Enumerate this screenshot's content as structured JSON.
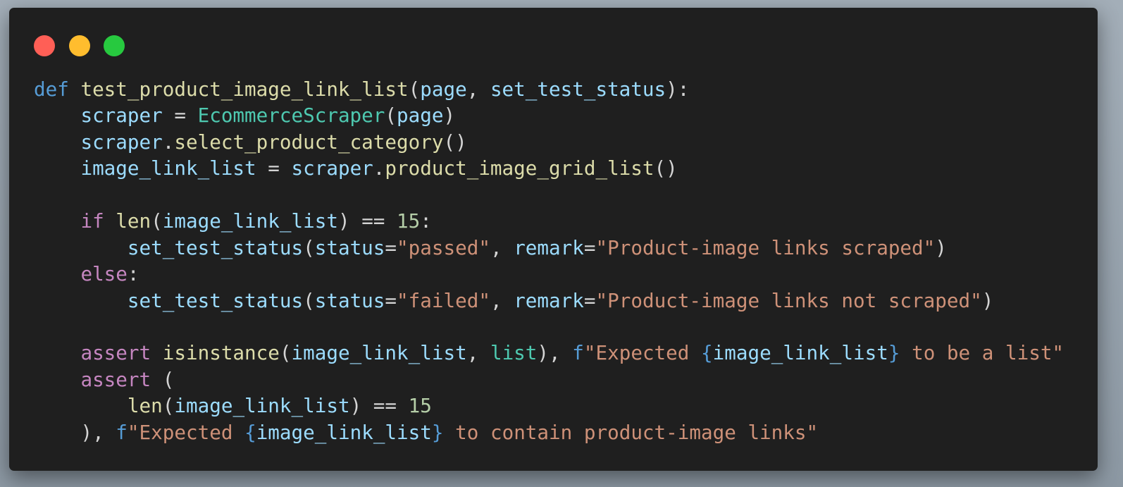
{
  "window_controls": [
    "close",
    "minimize",
    "maximize"
  ],
  "lines": [
    {
      "tokens": [
        {
          "t": "def ",
          "c": "kw"
        },
        {
          "t": "test_product_image_link_list",
          "c": "fn"
        },
        {
          "t": "(",
          "c": "p"
        },
        {
          "t": "page",
          "c": "var"
        },
        {
          "t": ", ",
          "c": "p"
        },
        {
          "t": "set_test_status",
          "c": "var"
        },
        {
          "t": "):",
          "c": "p"
        }
      ]
    },
    {
      "tokens": [
        {
          "t": "    ",
          "c": "p"
        },
        {
          "t": "scraper",
          "c": "var"
        },
        {
          "t": " = ",
          "c": "p"
        },
        {
          "t": "EcommerceScraper",
          "c": "cls"
        },
        {
          "t": "(",
          "c": "p"
        },
        {
          "t": "page",
          "c": "var"
        },
        {
          "t": ")",
          "c": "p"
        }
      ]
    },
    {
      "tokens": [
        {
          "t": "    ",
          "c": "p"
        },
        {
          "t": "scraper",
          "c": "var"
        },
        {
          "t": ".",
          "c": "p"
        },
        {
          "t": "select_product_category",
          "c": "fn"
        },
        {
          "t": "()",
          "c": "p"
        }
      ]
    },
    {
      "tokens": [
        {
          "t": "    ",
          "c": "p"
        },
        {
          "t": "image_link_list",
          "c": "var"
        },
        {
          "t": " = ",
          "c": "p"
        },
        {
          "t": "scraper",
          "c": "var"
        },
        {
          "t": ".",
          "c": "p"
        },
        {
          "t": "product_image_grid_list",
          "c": "fn"
        },
        {
          "t": "()",
          "c": "p"
        }
      ]
    },
    {
      "tokens": []
    },
    {
      "tokens": [
        {
          "t": "    ",
          "c": "p"
        },
        {
          "t": "if ",
          "c": "ctl"
        },
        {
          "t": "len",
          "c": "fn"
        },
        {
          "t": "(",
          "c": "p"
        },
        {
          "t": "image_link_list",
          "c": "var"
        },
        {
          "t": ") == ",
          "c": "p"
        },
        {
          "t": "15",
          "c": "num"
        },
        {
          "t": ":",
          "c": "p"
        }
      ]
    },
    {
      "tokens": [
        {
          "t": "        ",
          "c": "p"
        },
        {
          "t": "set_test_status",
          "c": "var"
        },
        {
          "t": "(",
          "c": "p"
        },
        {
          "t": "status",
          "c": "var"
        },
        {
          "t": "=",
          "c": "p"
        },
        {
          "t": "\"passed\"",
          "c": "str"
        },
        {
          "t": ", ",
          "c": "p"
        },
        {
          "t": "remark",
          "c": "var"
        },
        {
          "t": "=",
          "c": "p"
        },
        {
          "t": "\"Product-image links scraped\"",
          "c": "str"
        },
        {
          "t": ")",
          "c": "p"
        }
      ]
    },
    {
      "tokens": [
        {
          "t": "    ",
          "c": "p"
        },
        {
          "t": "else",
          "c": "ctl"
        },
        {
          "t": ":",
          "c": "p"
        }
      ]
    },
    {
      "tokens": [
        {
          "t": "        ",
          "c": "p"
        },
        {
          "t": "set_test_status",
          "c": "var"
        },
        {
          "t": "(",
          "c": "p"
        },
        {
          "t": "status",
          "c": "var"
        },
        {
          "t": "=",
          "c": "p"
        },
        {
          "t": "\"failed\"",
          "c": "str"
        },
        {
          "t": ", ",
          "c": "p"
        },
        {
          "t": "remark",
          "c": "var"
        },
        {
          "t": "=",
          "c": "p"
        },
        {
          "t": "\"Product-image links not scraped\"",
          "c": "str"
        },
        {
          "t": ")",
          "c": "p"
        }
      ]
    },
    {
      "tokens": []
    },
    {
      "tokens": [
        {
          "t": "    ",
          "c": "p"
        },
        {
          "t": "assert ",
          "c": "ctl"
        },
        {
          "t": "isinstance",
          "c": "fn"
        },
        {
          "t": "(",
          "c": "p"
        },
        {
          "t": "image_link_list",
          "c": "var"
        },
        {
          "t": ", ",
          "c": "p"
        },
        {
          "t": "list",
          "c": "cls"
        },
        {
          "t": "), ",
          "c": "p"
        },
        {
          "t": "f",
          "c": "kw"
        },
        {
          "t": "\"Expected ",
          "c": "str"
        },
        {
          "t": "{",
          "c": "kw"
        },
        {
          "t": "image_link_list",
          "c": "var"
        },
        {
          "t": "}",
          "c": "kw"
        },
        {
          "t": " to be a list\"",
          "c": "str"
        }
      ]
    },
    {
      "tokens": [
        {
          "t": "    ",
          "c": "p"
        },
        {
          "t": "assert ",
          "c": "ctl"
        },
        {
          "t": "(",
          "c": "p"
        }
      ]
    },
    {
      "tokens": [
        {
          "t": "        ",
          "c": "p"
        },
        {
          "t": "len",
          "c": "fn"
        },
        {
          "t": "(",
          "c": "p"
        },
        {
          "t": "image_link_list",
          "c": "var"
        },
        {
          "t": ") == ",
          "c": "p"
        },
        {
          "t": "15",
          "c": "num"
        }
      ]
    },
    {
      "tokens": [
        {
          "t": "    ",
          "c": "p"
        },
        {
          "t": "), ",
          "c": "p"
        },
        {
          "t": "f",
          "c": "kw"
        },
        {
          "t": "\"Expected ",
          "c": "str"
        },
        {
          "t": "{",
          "c": "kw"
        },
        {
          "t": "image_link_list",
          "c": "var"
        },
        {
          "t": "}",
          "c": "kw"
        },
        {
          "t": " to contain product-image links\"",
          "c": "str"
        }
      ]
    }
  ]
}
